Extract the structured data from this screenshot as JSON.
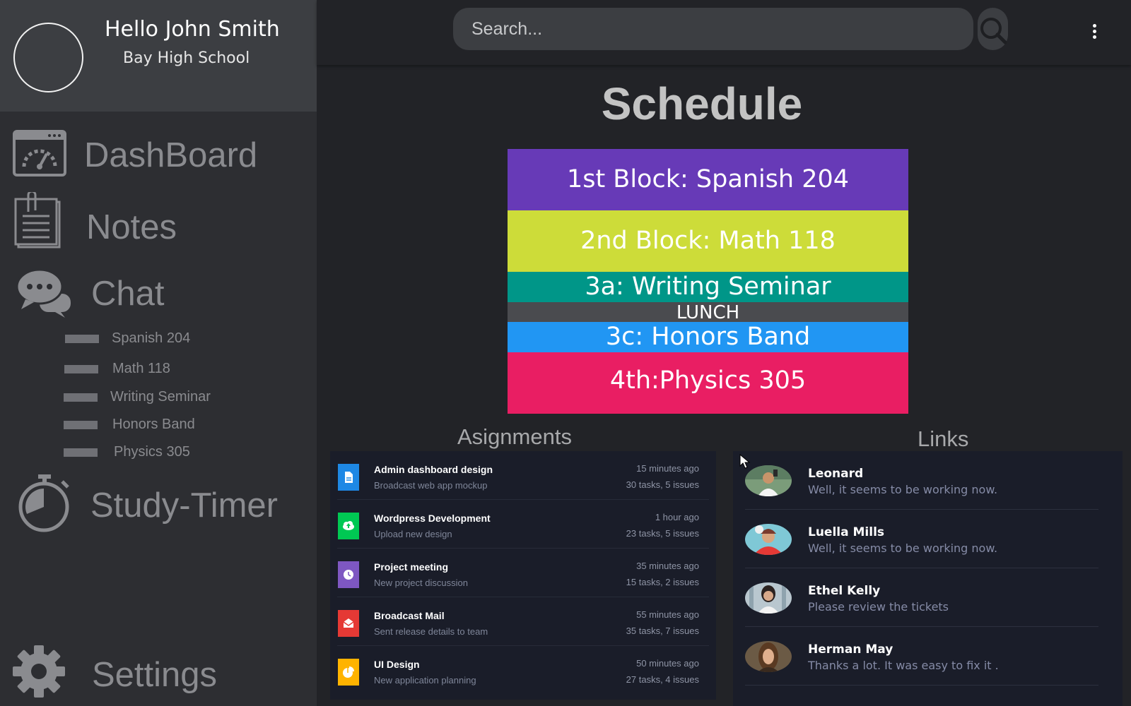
{
  "user": {
    "greeting": "Hello John Smith",
    "school": "Bay High School"
  },
  "sidebar": {
    "nav": [
      {
        "label": "DashBoard",
        "icon": "dashboard-icon"
      },
      {
        "label": "Notes",
        "icon": "notes-icon"
      },
      {
        "label": "Chat",
        "icon": "chat-icon"
      },
      {
        "label": "Study-Timer",
        "icon": "stopwatch-icon"
      },
      {
        "label": "Settings",
        "icon": "gear-icon"
      }
    ],
    "chat_channels": [
      "Spanish 204",
      "Math 118",
      "Writing Seminar",
      "Honors Band",
      "Physics 305"
    ]
  },
  "search": {
    "placeholder": "Search..."
  },
  "schedule": {
    "title": "Schedule",
    "blocks": [
      {
        "label": "1st Block: Spanish 204",
        "color": "#673ab7"
      },
      {
        "label": "2nd Block: Math 118",
        "color": "#cddc39"
      },
      {
        "label": "3a: Writing Seminar",
        "color": "#009688"
      },
      {
        "label": "LUNCH",
        "color": "#4a4b4f"
      },
      {
        "label": "3c: Honors Band",
        "color": "#2196f3"
      },
      {
        "label": "4th:Physics 305",
        "color": "#e91e63"
      }
    ]
  },
  "assignments": {
    "heading": "Asignments",
    "items": [
      {
        "title": "Admin dashboard design",
        "subtitle": "Broadcast web app mockup",
        "time": "15 minutes ago",
        "meta": "30 tasks, 5 issues",
        "color": "#1e88e5",
        "icon": "document-icon"
      },
      {
        "title": "Wordpress Development",
        "subtitle": "Upload new design",
        "time": "1 hour ago",
        "meta": "23 tasks, 5 issues",
        "color": "#00c853",
        "icon": "cloud-upload-icon"
      },
      {
        "title": "Project meeting",
        "subtitle": "New project discussion",
        "time": "35 minutes ago",
        "meta": "15 tasks, 2 issues",
        "color": "#7e57c2",
        "icon": "clock-icon"
      },
      {
        "title": "Broadcast Mail",
        "subtitle": "Sent release details to team",
        "time": "55 minutes ago",
        "meta": "35 tasks, 7 issues",
        "color": "#e53935",
        "icon": "mail-icon"
      },
      {
        "title": "UI Design",
        "subtitle": "New application planning",
        "time": "50 minutes ago",
        "meta": "27 tasks, 4 issues",
        "color": "#ffb300",
        "icon": "pie-chart-icon"
      }
    ]
  },
  "links": {
    "heading": "Links",
    "items": [
      {
        "name": "Leonard",
        "message": "Well, it seems to be working now."
      },
      {
        "name": "Luella Mills",
        "message": "Well, it seems to be working now."
      },
      {
        "name": "Ethel Kelly",
        "message": "Please review the tickets"
      },
      {
        "name": "Herman May",
        "message": "Thanks a lot. It was easy to fix it ."
      }
    ]
  }
}
